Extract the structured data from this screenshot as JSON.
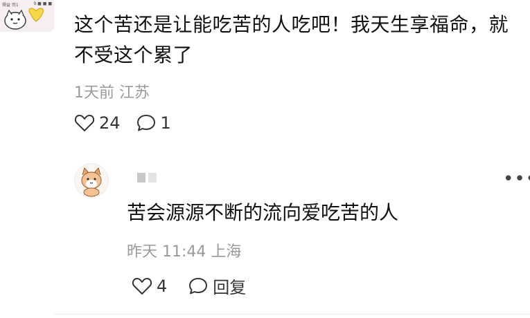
{
  "top_comment": {
    "avatar_tiny_left": "得益 司1",
    "avatar_tiny_right": "9 ■ ■ ■",
    "text": "这个苦还是让能吃苦的人吃吧！我天生享福命，就不受这个累了",
    "time": "1天前",
    "location": "江苏",
    "likes": "24",
    "replies": "1"
  },
  "reply": {
    "text": "苦会源源不断的流向爱吃苦的人",
    "time": "昨天 11:44",
    "location": "上海",
    "likes": "4",
    "reply_label": "回复",
    "more_icon": "more-horizontal-icon"
  },
  "colors": {
    "text": "#111111",
    "meta": "#9a9a9a",
    "icon": "#333333",
    "avatar_bg": "#f6eef0",
    "emoji_yellow": "#f6d84a"
  }
}
